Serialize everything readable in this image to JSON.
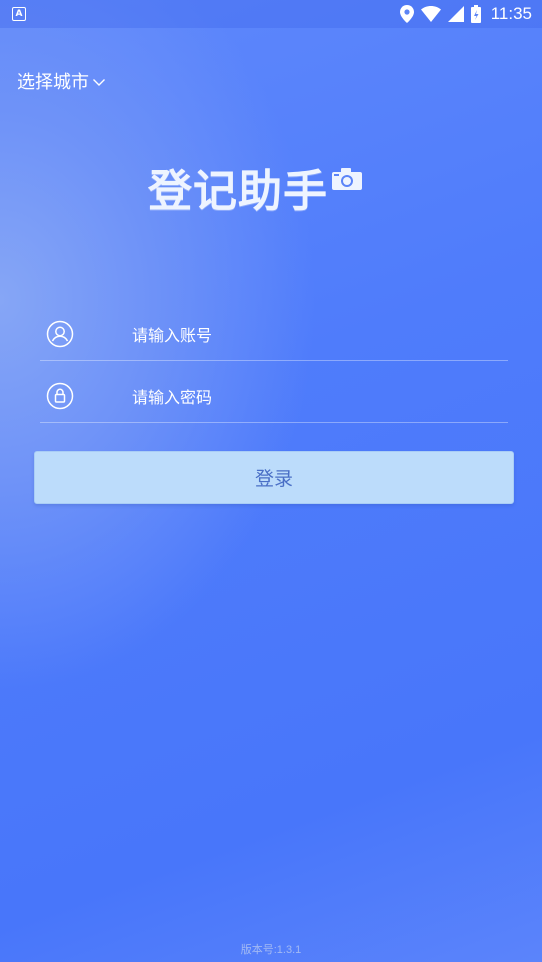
{
  "status_bar": {
    "app_badge": "A",
    "time": "11:35",
    "icons": [
      "location-icon",
      "wifi-icon",
      "signal-icon",
      "battery-charging-icon"
    ]
  },
  "city_select": {
    "label": "选择城市",
    "icon": "chevron-down-icon"
  },
  "logo": {
    "text": "登记助手",
    "icon": "camera-icon"
  },
  "form": {
    "account": {
      "placeholder": "请输入账号",
      "value": "",
      "icon": "user-icon"
    },
    "password": {
      "placeholder": "请输入密码",
      "value": "",
      "icon": "lock-icon"
    },
    "login_label": "登录"
  },
  "footer": {
    "version": "版本号:1.3.1"
  },
  "colors": {
    "background": "#5580fb",
    "button_bg": "#bcdcfb",
    "button_text": "#4a6fc6"
  }
}
